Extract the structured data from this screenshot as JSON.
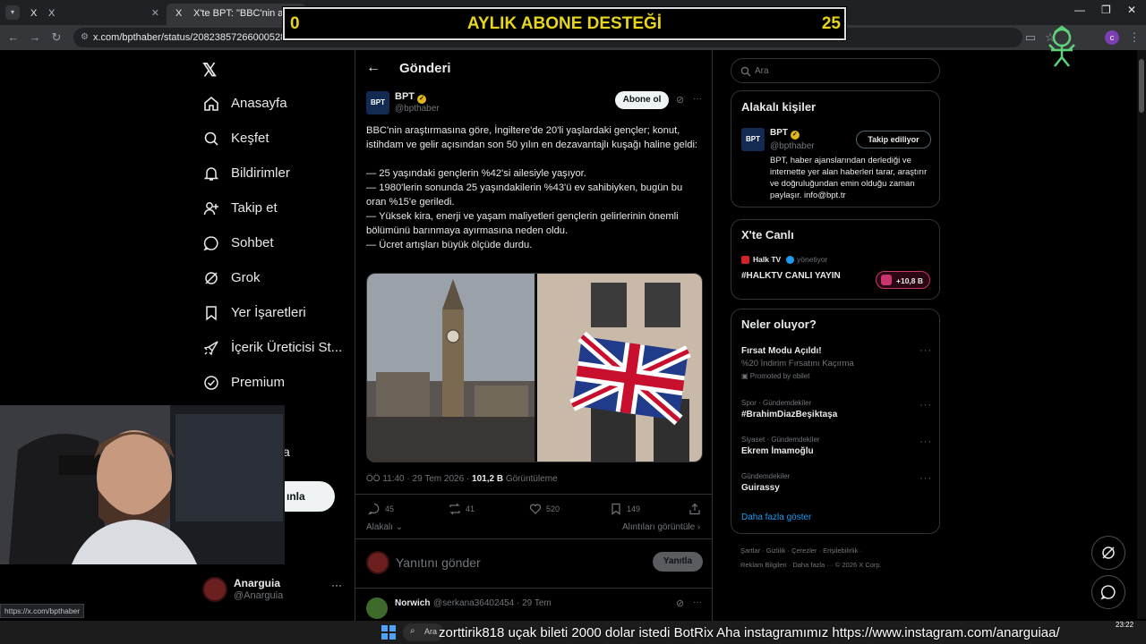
{
  "browser": {
    "tabs": [
      {
        "icon": "X",
        "label": "X"
      },
      {
        "icon": "X",
        "label": "X'te BPT: \"BBC'nin araştırması"
      }
    ],
    "new_tab": "+",
    "url": "x.com/bpthaber/status/2082385726600052847",
    "status_url": "https://x.com/bpthaber"
  },
  "overlay": {
    "banner_left": "0",
    "banner_title": "AYLIK ABONE DESTEĞİ",
    "banner_right": "25",
    "ticker": "zorttirik818  uçak bileti 2000 dolar istedi   BotRix Aha instagramımız https://www.instagram.com/anarguiaa/"
  },
  "nav": {
    "items": [
      {
        "icon": "home-icon",
        "label": "Anasayfa"
      },
      {
        "icon": "search-icon",
        "label": "Keşfet"
      },
      {
        "icon": "bell-icon",
        "label": "Bildirimler"
      },
      {
        "icon": "person-add-icon",
        "label": "Takip et"
      },
      {
        "icon": "chat-icon",
        "label": "Sohbet"
      },
      {
        "icon": "grok-icon",
        "label": "Grok"
      },
      {
        "icon": "bookmark-icon",
        "label": "Yer İşaretleri"
      },
      {
        "icon": "rocket-icon",
        "label": "İçerik Üreticisi St..."
      },
      {
        "icon": "verified-icon",
        "label": "Premium"
      }
    ],
    "post_button": "ınla",
    "partial_text": "a"
  },
  "profile": {
    "name": "Anarguia",
    "handle": "@Anarguia"
  },
  "post": {
    "header": "Gönderi",
    "author": "BPT",
    "handle": "@bpthaber",
    "subscribe": "Abone ol",
    "paragraph": "BBC'nin araştırmasına göre, İngiltere'de 20'li yaşlardaki gençler; konut, istihdam ve gelir açısından son 50 yılın en dezavantajlı kuşağı haline geldi:",
    "bullets": [
      "— 25 yaşındaki gençlerin %42'si ailesiyle yaşıyor.",
      "— 1980'lerin sonunda 25 yaşındakilerin %43'ü ev sahibiyken, bugün bu oran %15'e geriledi.",
      "— Yüksek kira, enerji ve yaşam maliyetleri gençlerin gelirlerinin önemli bölümünü barınmaya ayırmasına neden oldu.",
      "— Ücret artışları büyük ölçüde durdu."
    ],
    "time": "ÖÖ 11:40 · 29 Tem 2026 · ",
    "views": "101,2 B",
    "views_label": " Görüntüleme",
    "stats": {
      "replies": "45",
      "reposts": "41",
      "likes": "520",
      "bookmarks": "149"
    },
    "related": "Alakalı",
    "quotes": "Alıntıları görüntüle ›",
    "reply_placeholder": "Yanıtını gönder",
    "reply_button": "Yanıtla"
  },
  "reply": {
    "name": "Norwich",
    "handle": "@serkana36402454 · 29 Tem"
  },
  "right": {
    "search_placeholder": "Ara",
    "related_title": "Alakalı kişiler",
    "person": {
      "name": "BPT",
      "handle": "@bpthaber",
      "follow": "Takip ediliyor",
      "bio": "BPT, haber ajanslarından derlediği ve internette yer alan haberleri tarar, araştırır ve doğruluğundan emin olduğu zaman paylaşır. info@bpt.tr"
    },
    "live_title": "X'te Canlı",
    "live": {
      "host": "Halk TV",
      "role": "yönetiyor",
      "title": "#HALKTV CANLI YAYIN",
      "count": "+10,8 B"
    },
    "trends_title": "Neler oluyor?",
    "trends": [
      {
        "cat": "",
        "title": "Fırsat Modu Açıldı!",
        "sub": "%20 İndirim Fırsatını Kaçırma",
        "promo": "Promoted by obilet"
      },
      {
        "cat": "Spor · Gündemdekiler",
        "title": "#BrahimDiazBeşiktaşa"
      },
      {
        "cat": "Siyaset · Gündemdekiler",
        "title": "Ekrem İmamoğlu"
      },
      {
        "cat": "Gündemdekiler",
        "title": "Guirassy"
      }
    ],
    "more": "Daha fazla göster",
    "footer1": "Şartlar  ·  Gizlilik  ·  Çerezler  ·  Erişilebilirlik  ·",
    "footer2": "Reklam Bilgileri  ·  Daha fazla ···  © 2026 X Corp."
  },
  "taskbar": {
    "search": "Ara",
    "time": "23:22"
  },
  "colors": {
    "accent": "#1d9bf0",
    "banner": "#e6d51a",
    "verified": "#e2b719"
  }
}
